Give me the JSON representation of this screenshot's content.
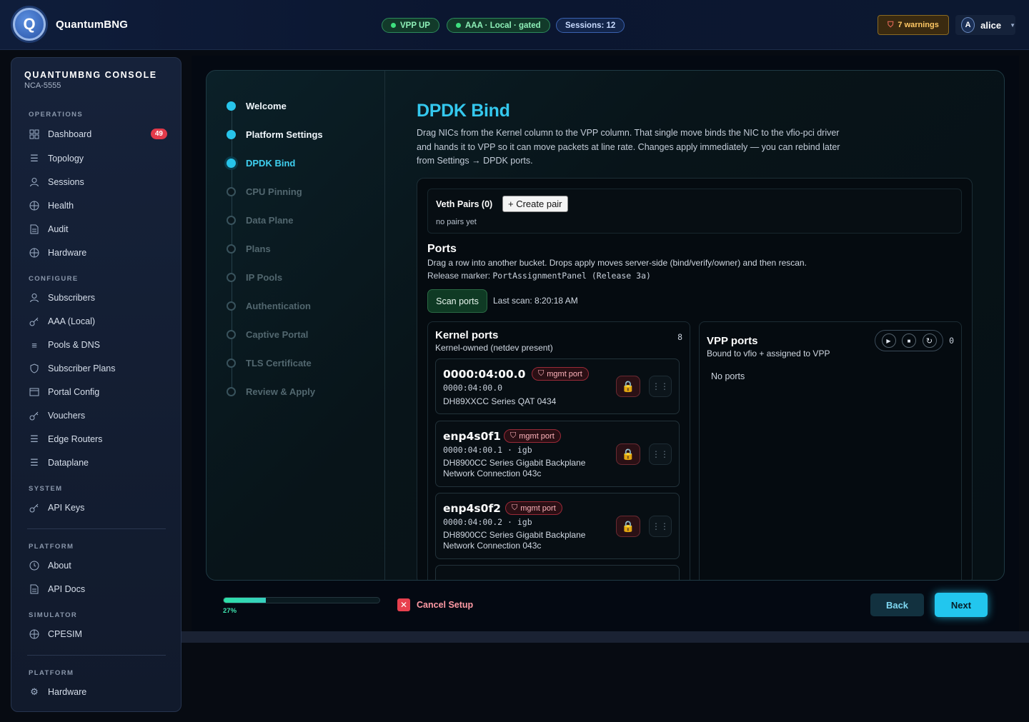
{
  "app": {
    "logo_letter": "Q",
    "brand": "QuantumBNG",
    "status_pills": [
      {
        "label": "VPP UP",
        "color": "#3ee07f"
      },
      {
        "label": "AAA · Local · gated",
        "color": "#3ee07f"
      },
      {
        "label": "Sessions: 12"
      }
    ],
    "warnings": "7 warnings",
    "user": {
      "initial": "A",
      "name": "alice"
    }
  },
  "sidebar": {
    "title": "QUANTUMBNG CONSOLE",
    "subtitle": "NCA-5555",
    "sections": [
      {
        "label": "OPERATIONS",
        "items": [
          {
            "label": "Dashboard",
            "icon": "grid-icon",
            "badge": "49"
          },
          {
            "label": "Topology",
            "icon": "sliders-icon"
          },
          {
            "label": "Sessions",
            "icon": "user-icon"
          },
          {
            "label": "Health",
            "icon": "globe-icon"
          },
          {
            "label": "Audit",
            "icon": "document-icon"
          },
          {
            "label": "Hardware",
            "icon": "globe-icon"
          }
        ]
      },
      {
        "label": "CONFIGURE",
        "items": [
          {
            "label": "Subscribers",
            "icon": "user-icon"
          },
          {
            "label": "AAA (Local)",
            "icon": "key-icon"
          },
          {
            "label": "Pools & DNS",
            "icon": "list-icon"
          },
          {
            "label": "Subscriber Plans",
            "icon": "shield-icon"
          },
          {
            "label": "Portal Config",
            "icon": "window-icon"
          },
          {
            "label": "Vouchers",
            "icon": "key-icon"
          },
          {
            "label": "Edge Routers",
            "icon": "sliders-icon"
          },
          {
            "label": "Dataplane",
            "icon": "sliders-icon"
          }
        ]
      },
      {
        "label": "SYSTEM",
        "items": [
          {
            "label": "API Keys",
            "icon": "key-icon"
          }
        ]
      },
      {
        "label": "PLATFORM",
        "items": [
          {
            "label": "About",
            "icon": "clock-icon"
          },
          {
            "label": "API Docs",
            "icon": "document-icon"
          }
        ]
      },
      {
        "label": "SIMULATOR",
        "items": [
          {
            "label": "CPESIM",
            "icon": "globe-icon"
          }
        ]
      },
      {
        "label": "PLATFORM",
        "items": [
          {
            "label": "Hardware",
            "icon": "gear-icon"
          }
        ]
      }
    ]
  },
  "wizard": {
    "steps": [
      {
        "label": "Welcome",
        "state": "done"
      },
      {
        "label": "Platform Settings",
        "state": "done"
      },
      {
        "label": "DPDK Bind",
        "state": "active"
      },
      {
        "label": "CPU Pinning",
        "state": "todo"
      },
      {
        "label": "Data Plane",
        "state": "todo"
      },
      {
        "label": "Plans",
        "state": "todo"
      },
      {
        "label": "IP Pools",
        "state": "todo"
      },
      {
        "label": "Authentication",
        "state": "todo"
      },
      {
        "label": "Captive Portal",
        "state": "todo"
      },
      {
        "label": "TLS Certificate",
        "state": "todo"
      },
      {
        "label": "Review & Apply",
        "state": "todo"
      }
    ],
    "title": "DPDK Bind",
    "description": "Drag NICs from the Kernel column to the VPP column. That single move binds the NIC to the vfio-pci driver and hands it to VPP so it can move packets at line rate. Changes apply immediately — you can rebind later from Settings → DPDK ports.",
    "veth": {
      "title": "Veth Pairs (0)",
      "create_label": "+ Create pair",
      "empty": "no pairs yet"
    },
    "ports": {
      "heading": "Ports",
      "description": "Drag a row into another bucket. Drops apply moves server-side (bind/verify/owner) and then rescan.",
      "release_prefix": "Release marker:",
      "release_code": "PortAssignmentPanel (Release 3a)",
      "scan_label": "Scan ports",
      "last_scan": "Last scan: 8:20:18 AM"
    },
    "kernel": {
      "title": "Kernel ports",
      "subtitle": "Kernel-owned (netdev present)",
      "count": "8",
      "rows": [
        {
          "name": "0000:04:00.0",
          "tag": "mgmt port",
          "pci": "0000:04:00.0",
          "desc": "DH89XXCC Series QAT 0434"
        },
        {
          "name": "enp4s0f1",
          "tag": "mgmt port",
          "pci": "0000:04:00.1 · igb",
          "desc": "DH8900CC Series Gigabit Backplane Network Connection 043c"
        },
        {
          "name": "enp4s0f2",
          "tag": "mgmt port",
          "pci": "0000:04:00.2 · igb",
          "desc": "DH8900CC Series Gigabit Backplane Network Connection 043c"
        }
      ]
    },
    "vpp": {
      "title": "VPP ports",
      "subtitle": "Bound to vfio + assigned to VPP",
      "count": "0",
      "empty": "No ports"
    }
  },
  "footer": {
    "progress": 0.27,
    "progress_label": "27%",
    "cancel_label": "Cancel Setup",
    "back_label": "Back",
    "next_label": "Next"
  }
}
